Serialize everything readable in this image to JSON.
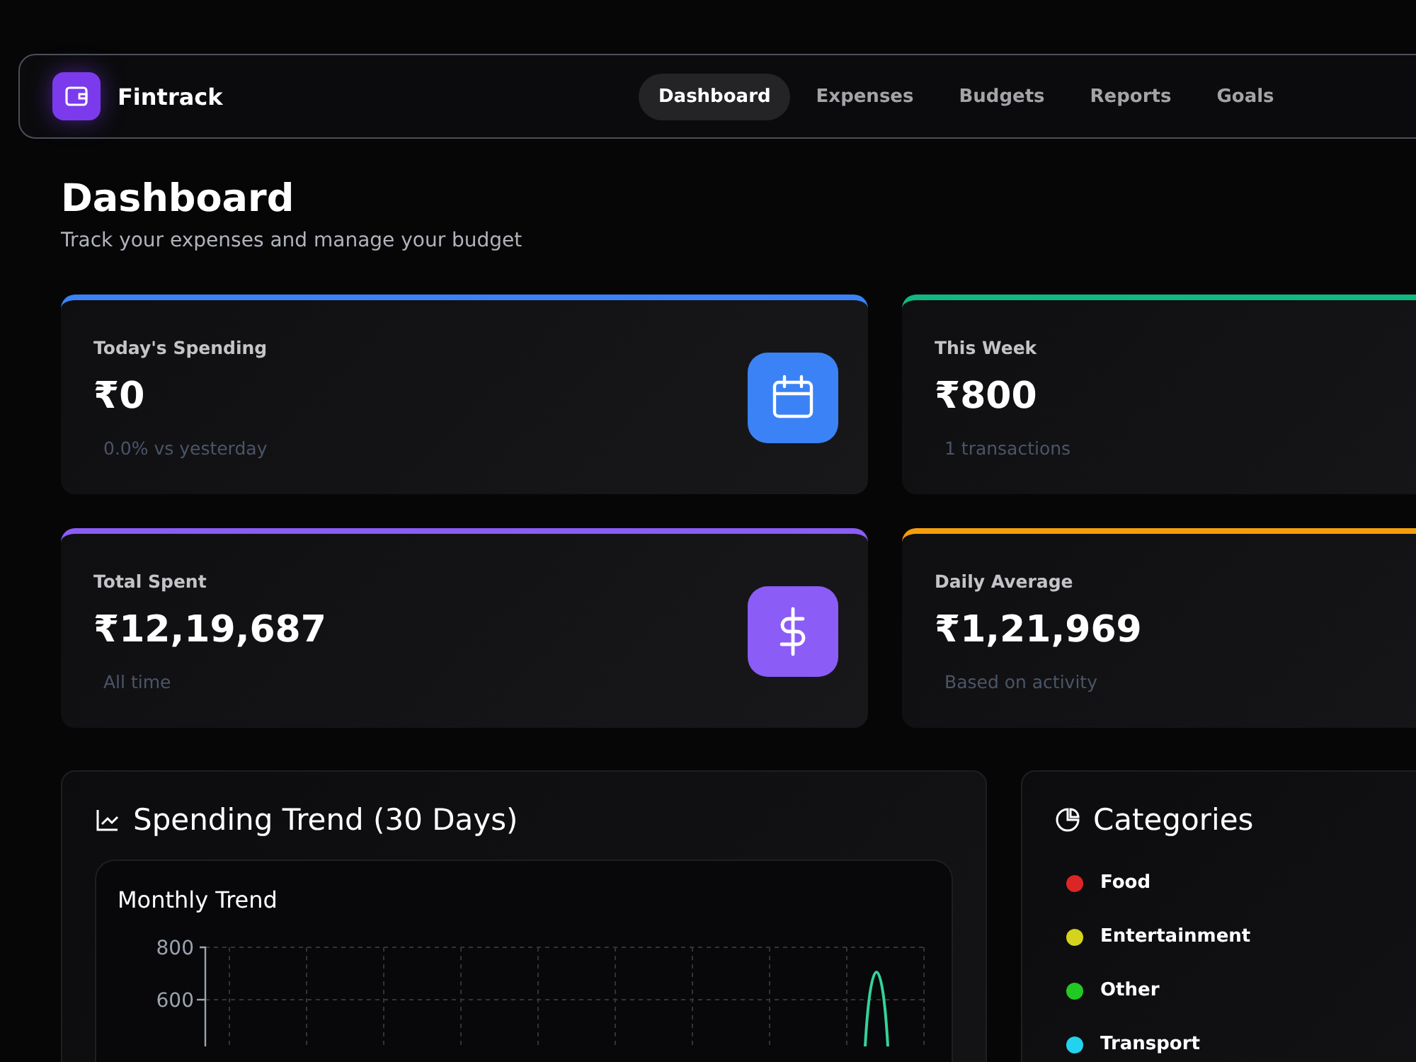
{
  "app": {
    "name": "Fintrack"
  },
  "nav": [
    {
      "label": "Dashboard",
      "selected": true
    },
    {
      "label": "Expenses",
      "selected": false
    },
    {
      "label": "Budgets",
      "selected": false
    },
    {
      "label": "Reports",
      "selected": false
    },
    {
      "label": "Goals",
      "selected": false
    }
  ],
  "page": {
    "title": "Dashboard",
    "subtitle": "Track your expenses and manage your budget"
  },
  "stats": [
    {
      "label": "Today's Spending",
      "value": "₹0",
      "note": "0.0% vs yesterday",
      "color": "#3b82f6",
      "kind": "calendar"
    },
    {
      "label": "This Week",
      "value": "₹800",
      "note": "1 transactions",
      "color": "#10b981",
      "kind": "plain"
    },
    {
      "label": "Total Spent",
      "value": "₹12,19,687",
      "note": "All time",
      "color": "#8b5cf6",
      "kind": "dollar"
    },
    {
      "label": "Daily Average",
      "value": "₹1,21,969",
      "note": "Based on activity",
      "color": "#f59e0b",
      "kind": "plain"
    }
  ],
  "trend": {
    "title": "Spending Trend (30 Days)",
    "chart_title": "Monthly Trend",
    "y_tick_labels": [
      "800",
      "600"
    ]
  },
  "categories": {
    "title": "Categories",
    "items": [
      {
        "name": "Food",
        "color": "#dc2626"
      },
      {
        "name": "Entertainment",
        "color": "#d4d41e"
      },
      {
        "name": "Other",
        "color": "#22c922"
      },
      {
        "name": "Transport",
        "color": "#22d3ee"
      }
    ]
  }
}
